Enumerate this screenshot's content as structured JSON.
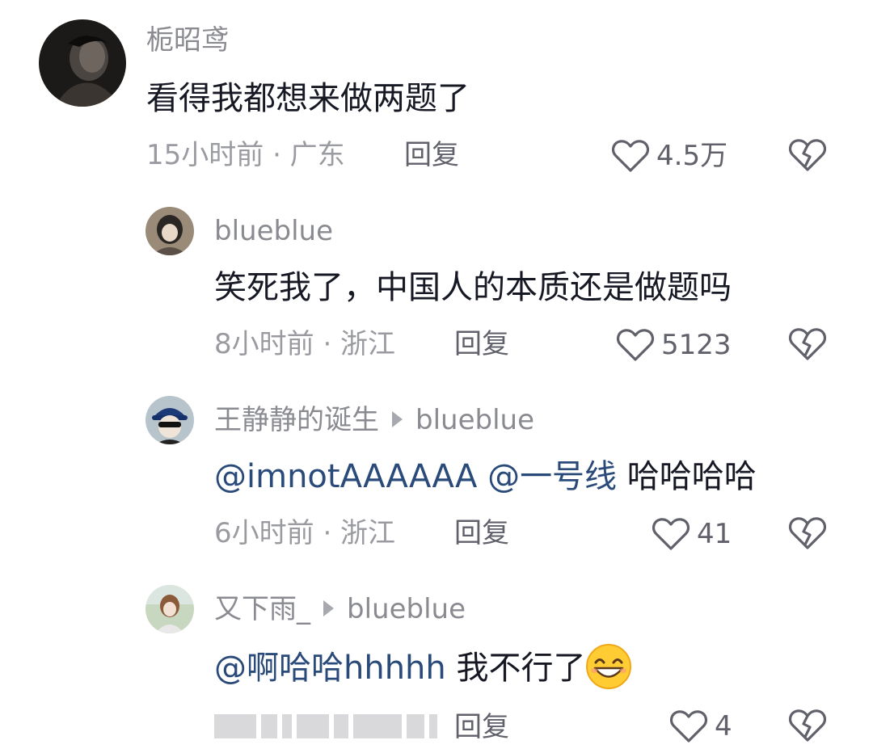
{
  "comments": [
    {
      "author": "栀昭鸢",
      "text": "看得我都想来做两题了",
      "time_location": "15小时前 · 广东",
      "reply_label": "回复",
      "likes": "4.5万",
      "avatar_icon": "dark-portrait-avatar"
    },
    {
      "author": "blueblue",
      "text": "笑死我了，中国人的本质还是做题吗",
      "time_location": "8小时前 · 浙江",
      "reply_label": "回复",
      "likes": "5123",
      "avatar_icon": "girl-portrait-avatar"
    },
    {
      "author": "王静静的诞生",
      "reply_to": "blueblue",
      "mention1": "@imnotAAAAAA",
      "mention2": "@一号线",
      "text": "哈哈哈哈",
      "time_location": "6小时前 · 浙江",
      "reply_label": "回复",
      "likes": "41",
      "avatar_icon": "cap-sunglasses-avatar"
    },
    {
      "author": "又下雨_",
      "reply_to": "blueblue",
      "mention1": "@啊哈哈hhhhh",
      "text": "我不行了",
      "emoji": "grinning-face-emoji",
      "time_location": "",
      "reply_label": "回复",
      "likes": "4",
      "avatar_icon": "girl-outdoor-avatar"
    }
  ],
  "colors": {
    "name": "#8a8b91",
    "mention": "#2a4a7a",
    "text": "#161823",
    "meta": "#9a9ba0"
  }
}
